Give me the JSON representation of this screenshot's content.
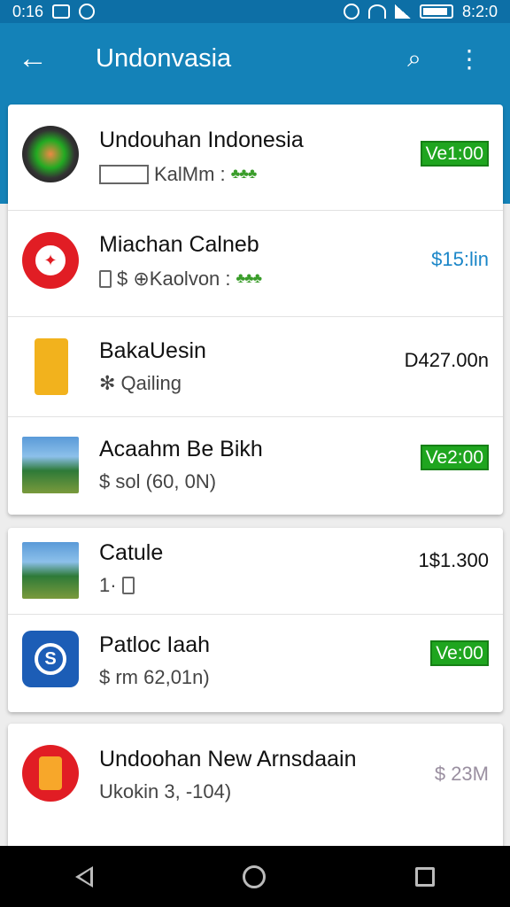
{
  "status_bar": {
    "time": "0:16",
    "clock": "8:2:0"
  },
  "app_bar": {
    "title": "Undonvasia",
    "back_glyph": "←",
    "search_glyph": "⌕",
    "more_glyph": "⋮"
  },
  "cards": [
    {
      "rows": [
        {
          "name": "Undouhan Indonesia",
          "sub": "KalMm  :",
          "stars": "♣♣♣",
          "price": "Ve1:00",
          "price_style": "badge",
          "icon": "colorful-circle-icon"
        },
        {
          "name": "Miachan Calneb",
          "sub": "$  ⊕Kaolvon  :",
          "stars": "♣♣♣",
          "price": "$15:lin",
          "price_style": "blue",
          "icon": "red-emblem-icon"
        },
        {
          "name": "BakaUesin",
          "sub": "✻  Qailing",
          "stars": "",
          "price": "D427.00n",
          "price_style": "dark",
          "icon": "yellow-document-icon"
        },
        {
          "name": "Acaahm Be Bikh",
          "sub": "$  sol (60, 0N)",
          "stars": "",
          "price": "Ve2:00",
          "price_style": "badge",
          "icon": "photo-thumbnail-icon"
        }
      ]
    },
    {
      "rows": [
        {
          "name": "Catule",
          "sub": "1·",
          "stars": "",
          "price": "1$1.300",
          "price_style": "dark",
          "icon": "photo-thumbnail-icon"
        },
        {
          "name": "Patloc Iaah",
          "sub": "$  rm 62,01n)",
          "stars": "",
          "price": "Ve:00",
          "price_style": "badge",
          "icon": "blue-s-icon"
        }
      ]
    },
    {
      "rows": [
        {
          "name": "Undoohan New Arnsdaain",
          "sub": "Ukokin 3, -104)",
          "stars": "",
          "price": "$ 23M",
          "price_style": "gray",
          "icon": "red-phone-icon"
        }
      ]
    }
  ]
}
